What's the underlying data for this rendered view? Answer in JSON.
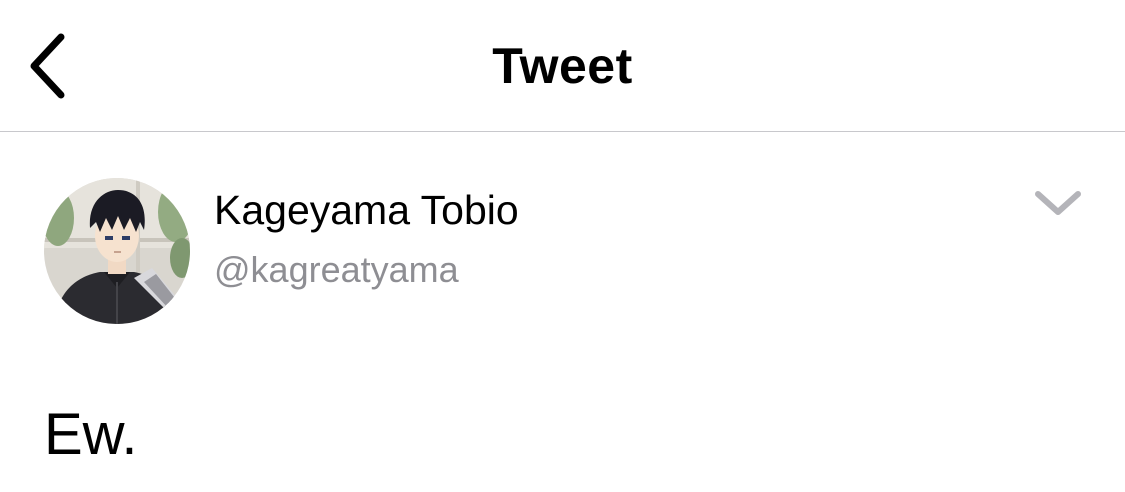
{
  "nav": {
    "title": "Tweet",
    "back_icon": "chevron-left-icon"
  },
  "tweet": {
    "author": {
      "display_name": "Kageyama Tobio",
      "handle": "@kagreatyama",
      "avatar": "avatar-image"
    },
    "more_icon": "chevron-down-icon",
    "text": "Ew."
  },
  "colors": {
    "text_primary": "#000000",
    "text_secondary": "#8e8e93",
    "separator": "#c8c8cc",
    "chevron_down": "#b4b4b9"
  }
}
